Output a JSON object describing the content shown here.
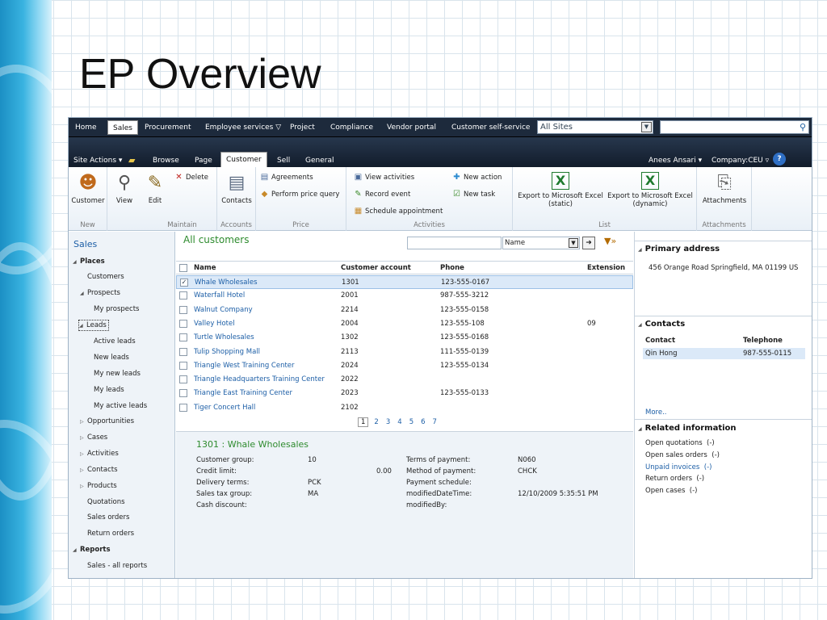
{
  "slide": {
    "title": "EP Overview"
  },
  "topnav": {
    "items": [
      "Home",
      "Sales",
      "Procurement",
      "Employee services",
      "Project",
      "Compliance",
      "Vendor portal",
      "Customer self-service"
    ],
    "sites_value": "All Sites"
  },
  "ribbon_tabs": {
    "site_actions": "Site Actions",
    "browse": "Browse",
    "page": "Page",
    "customer": "Customer",
    "sell": "Sell",
    "general": "General",
    "user": "Anees Ansari",
    "company": "Company:CEU"
  },
  "ribbon": {
    "new_group": "New",
    "customer": "Customer",
    "maintain_group": "Maintain",
    "view": "View",
    "edit": "Edit",
    "delete": "Delete",
    "accounts_group": "Accounts",
    "contacts": "Contacts",
    "price_group": "Price",
    "agreements": "Agreements",
    "perform_price_query": "Perform price query",
    "activities_group": "Activities",
    "view_activities": "View activities",
    "record_event": "Record event",
    "schedule_appointment": "Schedule appointment",
    "new_action": "New action",
    "new_task": "New task",
    "list_group": "List",
    "export_static": "Export to Microsoft Excel",
    "export_static_sub": "(static)",
    "export_dynamic": "Export to Microsoft Excel",
    "export_dynamic_sub": "(dynamic)",
    "attachments_group": "Attachments",
    "attachments": "Attachments"
  },
  "leftnav": {
    "sales": "Sales",
    "places": "Places",
    "customers": "Customers",
    "prospects": "Prospects",
    "my_prospects": "My prospects",
    "leads": "Leads",
    "active_leads": "Active leads",
    "new_leads": "New leads",
    "my_new_leads": "My new leads",
    "my_leads": "My leads",
    "my_active_leads": "My active leads",
    "opportunities": "Opportunities",
    "cases": "Cases",
    "activities": "Activities",
    "contacts": "Contacts",
    "products": "Products",
    "quotations": "Quotations",
    "sales_orders": "Sales orders",
    "return_orders": "Return orders",
    "reports": "Reports",
    "sales_all_reports": "Sales - all reports"
  },
  "grid": {
    "title": "All customers",
    "filter_field": "Name",
    "columns": {
      "name": "Name",
      "account": "Customer account",
      "phone": "Phone",
      "extension": "Extension"
    },
    "rows": [
      {
        "name": "Whale Wholesales",
        "account": "1301",
        "phone": "123-555-0167",
        "ext": ""
      },
      {
        "name": "Waterfall Hotel",
        "account": "2001",
        "phone": "987-555-3212",
        "ext": ""
      },
      {
        "name": "Walnut Company",
        "account": "2214",
        "phone": "123-555-0158",
        "ext": ""
      },
      {
        "name": "Valley Hotel",
        "account": "2004",
        "phone": "123-555-108",
        "ext": "09"
      },
      {
        "name": "Turtle Wholesales",
        "account": "1302",
        "phone": "123-555-0168",
        "ext": ""
      },
      {
        "name": "Tulip Shopping Mall",
        "account": "2113",
        "phone": "111-555-0139",
        "ext": ""
      },
      {
        "name": "Triangle West Training Center",
        "account": "2024",
        "phone": "123-555-0134",
        "ext": ""
      },
      {
        "name": "Triangle Headquarters Training Center",
        "account": "2022",
        "phone": "",
        "ext": ""
      },
      {
        "name": "Triangle East Training Center",
        "account": "2023",
        "phone": "123-555-0133",
        "ext": ""
      },
      {
        "name": "Tiger Concert Hall",
        "account": "2102",
        "phone": "",
        "ext": ""
      }
    ],
    "pages": [
      "1",
      "2",
      "3",
      "4",
      "5",
      "6",
      "7"
    ]
  },
  "details": {
    "title": "1301 : Whale Wholesales",
    "customer_group_label": "Customer group:",
    "customer_group": "10",
    "credit_limit_label": "Credit limit:",
    "credit_limit": "0.00",
    "delivery_terms_label": "Delivery terms:",
    "delivery_terms": "PCK",
    "sales_tax_group_label": "Sales tax group:",
    "sales_tax_group": "MA",
    "cash_discount_label": "Cash discount:",
    "terms_of_payment_label": "Terms of payment:",
    "terms_of_payment": "N060",
    "method_of_payment_label": "Method of payment:",
    "method_of_payment": "CHCK",
    "payment_schedule_label": "Payment schedule:",
    "modified_datetime_label": "modifiedDateTime:",
    "modified_datetime": "12/10/2009 5:35:51 PM",
    "modified_by_label": "modifiedBy:"
  },
  "factbox": {
    "primary_address_title": "Primary address",
    "primary_address": "456 Orange Road Springfield, MA 01199 US",
    "contacts_title": "Contacts",
    "contact_col": "Contact",
    "telephone_col": "Telephone",
    "contact_name": "Qin Hong",
    "contact_phone": "987-555-0115",
    "more": "More..",
    "related_title": "Related information",
    "open_quotations": "Open quotations",
    "open_sales_orders": "Open sales orders",
    "unpaid_invoices": "Unpaid invoices",
    "return_orders": "Return orders",
    "open_cases": "Open cases",
    "count": "(-)"
  }
}
